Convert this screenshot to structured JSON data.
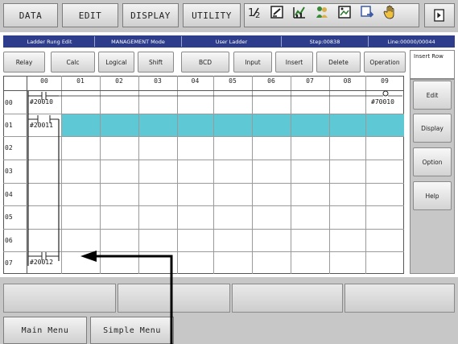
{
  "top_menu": {
    "data": "DATA",
    "edit": "EDIT",
    "display": "DISPLAY",
    "utility": "UTILITY"
  },
  "toolbar_icons": [
    "one-two-icon",
    "edit-check-icon",
    "chart-icon",
    "users-icon",
    "image-icon",
    "arrow-window-icon",
    "hand-icon"
  ],
  "end_icon": "end-page-icon",
  "status": {
    "screen": "Ladder Rung Edit",
    "mode": "MANAGEMENT Mode",
    "program": "User Ladder",
    "step": "Step:00838",
    "line": "Line:00000/00044"
  },
  "softkeys": [
    "Relay",
    "Calc",
    "Logical",
    "Shift",
    "BCD",
    "Input",
    "Insert",
    "Delete",
    "Operation"
  ],
  "insert_row_label": "Insert Row",
  "ladder": {
    "columns": [
      "00",
      "01",
      "02",
      "03",
      "04",
      "05",
      "06",
      "07",
      "08",
      "09"
    ],
    "rows": [
      "00",
      "01",
      "02",
      "03",
      "04",
      "05",
      "06",
      "07"
    ],
    "contacts": {
      "r00": "#20010",
      "r01": "#20011",
      "r07": "#20012"
    },
    "coil_r00": "#70010"
  },
  "side_buttons": [
    "Edit",
    "Display",
    "Option",
    "Help"
  ],
  "bottom_buttons": {
    "main_menu": "Main Menu",
    "simple_menu": "Simple Menu"
  },
  "colors": {
    "selected_row": "#5ec8d4",
    "status_bar": "#2d3d8c",
    "panel_gray": "#c7c7c7"
  }
}
